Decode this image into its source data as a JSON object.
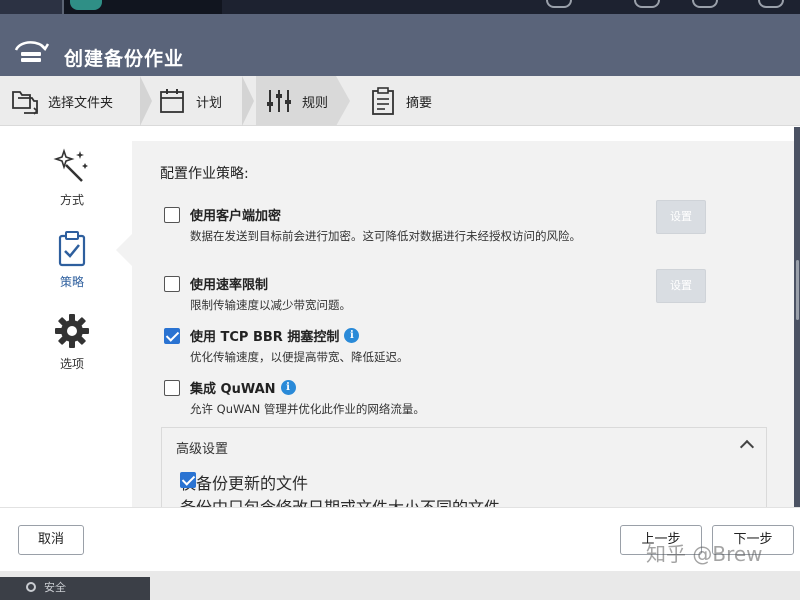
{
  "window": {
    "title": "创建备份作业"
  },
  "steps": [
    {
      "label": "选择文件夹",
      "icon": "folder-copy-icon"
    },
    {
      "label": "计划",
      "icon": "calendar-icon"
    },
    {
      "label": "规则",
      "icon": "sliders-icon"
    },
    {
      "label": "摘要",
      "icon": "clipboard-list-icon"
    }
  ],
  "active_step": "规则",
  "sidebar": {
    "items": [
      {
        "label": "方式",
        "icon": "magic-wand-icon"
      },
      {
        "label": "策略",
        "icon": "clipboard-check-icon"
      },
      {
        "label": "选项",
        "icon": "gear-icon"
      }
    ],
    "active": "策略"
  },
  "policy": {
    "section_title": "配置作业策略:",
    "options": [
      {
        "label": "使用客户端加密",
        "description": "数据在发送到目标前会进行加密。这可降低对数据进行未经授权访问的风险。",
        "checked": false,
        "settings_button": "设置",
        "has_info": false
      },
      {
        "label": "使用速率限制",
        "description": "限制传输速度以减少带宽问题。",
        "checked": false,
        "settings_button": "设置",
        "has_info": false
      },
      {
        "label": "使用 TCP BBR 拥塞控制",
        "description": "优化传输速度，以便提高带宽、降低延迟。",
        "checked": true,
        "has_info": true
      },
      {
        "label": "集成 QuWAN",
        "description": "允许 QuWAN 管理并优化此作业的网络流量。",
        "checked": false,
        "has_info": true
      }
    ],
    "info_glyph": "i"
  },
  "advanced": {
    "title": "高级设置",
    "expanded": true,
    "options": [
      {
        "label": "仅备份更新的文件",
        "description": "备份中只包含修改日期或文件大小不同的文件。",
        "checked": true
      }
    ]
  },
  "footer": {
    "cancel": "取消",
    "prev": "上一步",
    "next": "下一步",
    "watermark": "知乎 @Brew"
  },
  "taskbar": {
    "item": "安全"
  },
  "colors": {
    "titlebar": "#5a647a",
    "accent": "#2a73d2",
    "info": "#2a8ad8",
    "panel": "#f2f2f2"
  }
}
